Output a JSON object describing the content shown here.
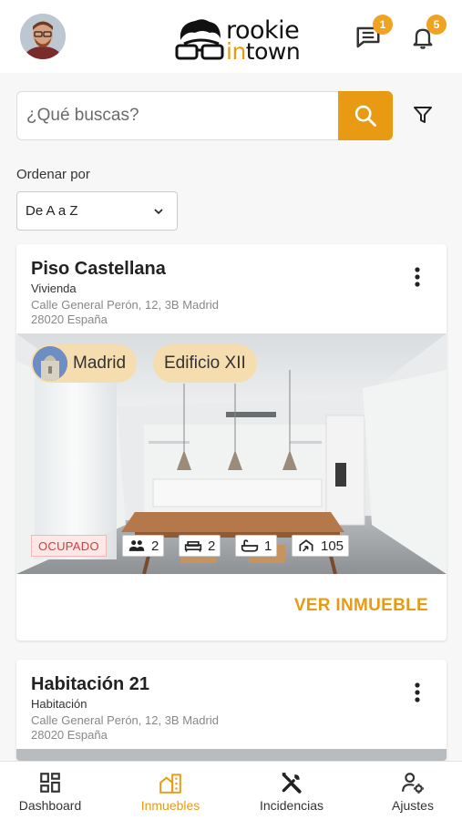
{
  "header": {
    "logo_line1": "rookie",
    "logo_line2_accent": "in",
    "logo_line2_rest": "town",
    "messages_count": "1",
    "notifications_count": "5"
  },
  "search": {
    "placeholder": "¿Qué buscas?"
  },
  "sort": {
    "label": "Ordenar por",
    "selected": "De A a Z"
  },
  "properties": [
    {
      "title": "Piso Castellana",
      "type": "Vivienda",
      "address": "Calle General Perón, 12, 3B Madrid",
      "postal": "28020 España",
      "city_chip": "Madrid",
      "building_chip": "Edificio XII",
      "status": "OCUPADO",
      "guests": "2",
      "beds": "2",
      "baths": "1",
      "area": "105",
      "action": "VER INMUEBLE"
    },
    {
      "title": "Habitación 21",
      "type": "Habitación",
      "address": "Calle General Perón, 12, 3B Madrid",
      "postal": "28020 España"
    }
  ],
  "nav": {
    "dashboard": "Dashboard",
    "inmuebles": "Inmuebles",
    "incidencias": "Incidencias",
    "ajustes": "Ajustes"
  },
  "colors": {
    "accent": "#e89b12",
    "chip_bg": "#f6ddb0",
    "status_red": "#d03d3d"
  }
}
